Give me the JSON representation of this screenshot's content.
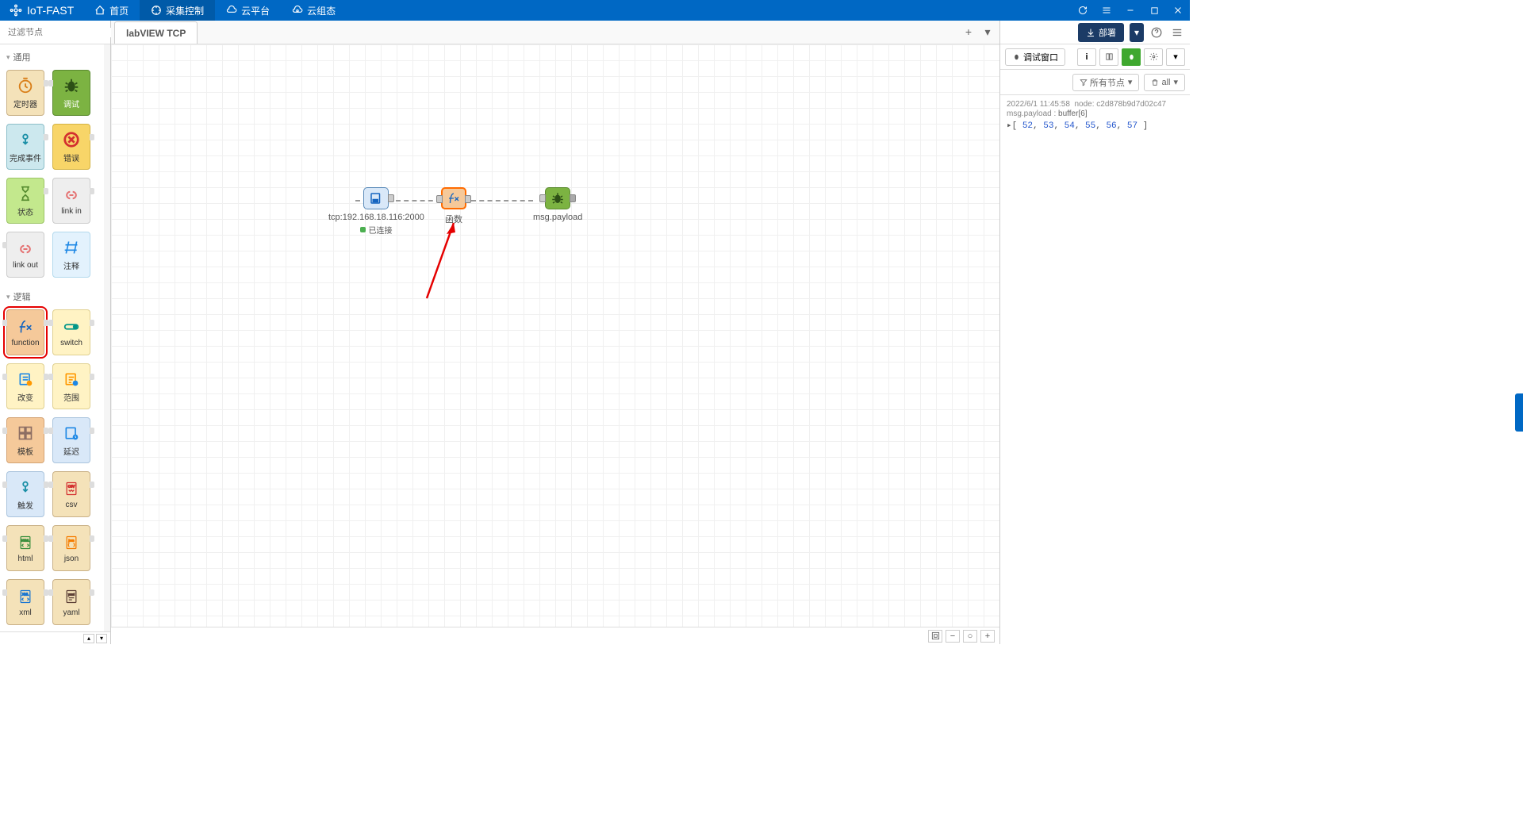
{
  "app_name": "IoT-FAST",
  "top_nav": {
    "home": "首页",
    "collect": "采集控制",
    "cloud_platform": "云平台",
    "cloud_config": "云组态"
  },
  "sidebar": {
    "filter_placeholder": "过滤节点",
    "cat_general": "通用",
    "cat_logic": "逻辑",
    "nodes": {
      "timer": "定时器",
      "debug": "调试",
      "complete": "完成事件",
      "error": "错误",
      "status": "状态",
      "link_in": "link in",
      "link_out": "link out",
      "comment": "注释",
      "function": "function",
      "switch": "switch",
      "change": "改变",
      "range": "范围",
      "template": "模板",
      "delay": "延迟",
      "trigger": "触发",
      "csv": "csv",
      "html": "html",
      "json": "json",
      "xml": "xml",
      "yaml": "yaml"
    }
  },
  "tab_name": "labVIEW TCP",
  "flow": {
    "tcp_label": "tcp:192.168.18.116:2000",
    "tcp_status": "已连接",
    "func_label": "函数",
    "debug_label": "msg.payload"
  },
  "right": {
    "deploy": "部署",
    "debug_tab": "调试窗口",
    "filter_all_nodes": "所有节点",
    "filter_all": "all",
    "debug_ts": "2022/6/1 11:45:58",
    "debug_node": "node: c2d878b9d7d02c47",
    "debug_path": "msg.payload",
    "debug_type": "buffer[6]",
    "debug_values": [
      "52",
      "53",
      "54",
      "55",
      "56",
      "57"
    ]
  }
}
